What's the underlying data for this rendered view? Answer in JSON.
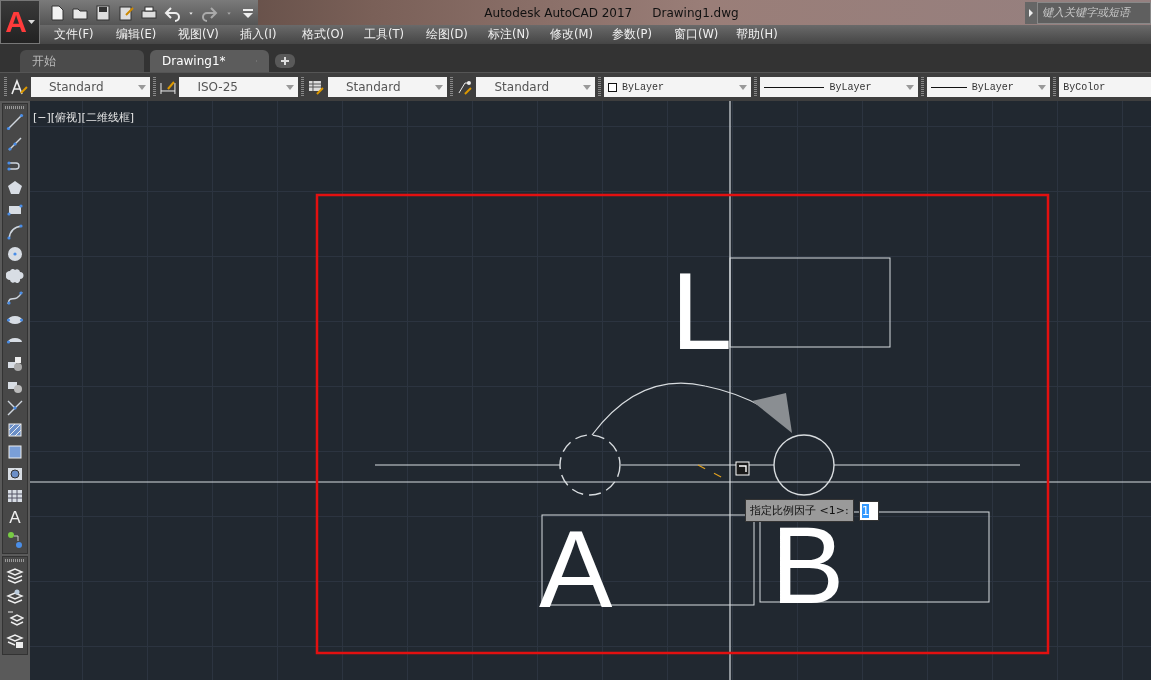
{
  "app": {
    "logo_letter": "A",
    "title": "Autodesk AutoCAD 2017",
    "file": "Drawing1.dwg",
    "search": {
      "placeholder": "键入关键字或短语"
    }
  },
  "menu": [
    "文件(F)",
    "编辑(E)",
    "视图(V)",
    "插入(I)",
    "格式(O)",
    "工具(T)",
    "绘图(D)",
    "标注(N)",
    "修改(M)",
    "参数(P)",
    "窗口(W)",
    "帮助(H)"
  ],
  "tabs": [
    {
      "label": "开始",
      "selected": false
    },
    {
      "label": "Drawing1*",
      "selected": true
    }
  ],
  "style_toolbar": [
    {
      "kind": "text-style",
      "value": "Standard"
    },
    {
      "kind": "dim-style",
      "value": "ISO-25"
    },
    {
      "kind": "table-style",
      "value": "Standard"
    },
    {
      "kind": "leader-style",
      "value": "Standard"
    },
    {
      "kind": "color",
      "value": "ByLayer"
    },
    {
      "kind": "linetype",
      "value": "ByLayer"
    },
    {
      "kind": "lineweight",
      "value": "ByLayer"
    },
    {
      "kind": "plotstyle",
      "value": "ByColor"
    }
  ],
  "left_toolbar": {
    "text_tool": "A"
  },
  "viewport": {
    "label": "[−][俯视][二维线框]"
  },
  "drawing": {
    "letters": [
      "L",
      "A",
      "B"
    ]
  },
  "prompt": {
    "text": "指定比例因子 <1>:",
    "value": "1"
  }
}
